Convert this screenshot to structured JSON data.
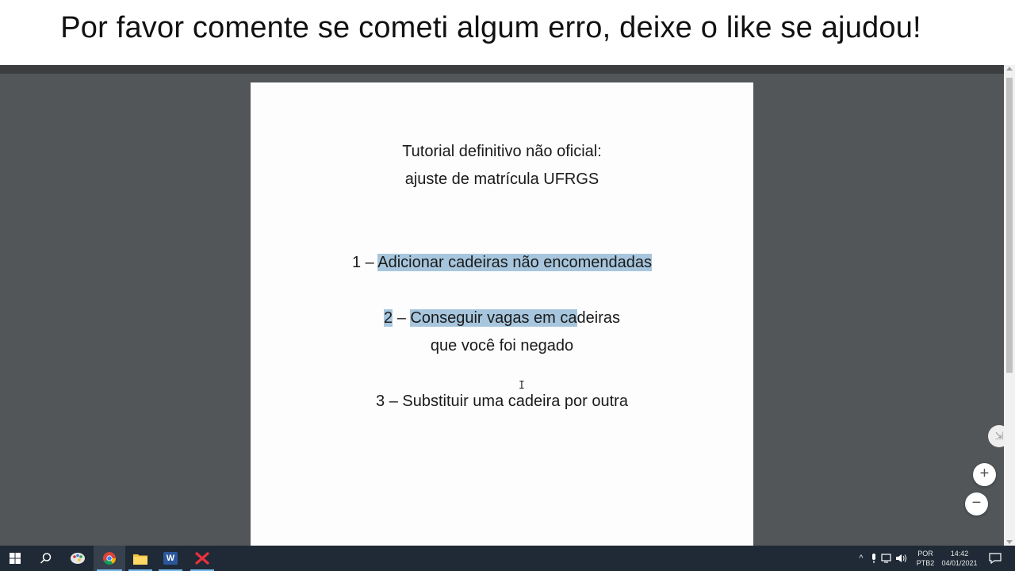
{
  "banner": {
    "text": "Por favor comente se cometi algum erro, deixe o like se ajudou!"
  },
  "document": {
    "title_line1": "Tutorial definitivo não oficial:",
    "title_line2": "ajuste de matrícula UFRGS",
    "item1_number": "1 – ",
    "item1_text": "Adicionar cadeiras não encomendadas",
    "item2_number": "2",
    "item2_dash": " – ",
    "item2_highlighted": "Conseguir vagas em ca",
    "item2_rest": "deiras",
    "item2_line2": "que você foi negado",
    "item3_text": "3 – Substituir uma cadeira por outra"
  },
  "viewer_controls": {
    "zoom_in": "+",
    "zoom_out": "−",
    "fit_page": "⇲"
  },
  "taskbar": {
    "language_top": "POR",
    "language_bottom": "PTB2",
    "time": "14:42",
    "date": "04/01/2021",
    "word_letter": "W"
  },
  "colors": {
    "highlight": "#a7c6dd",
    "viewer_bg": "#525659",
    "taskbar_bg": "#1f2a36",
    "accent_underline": "#76b9ed"
  }
}
